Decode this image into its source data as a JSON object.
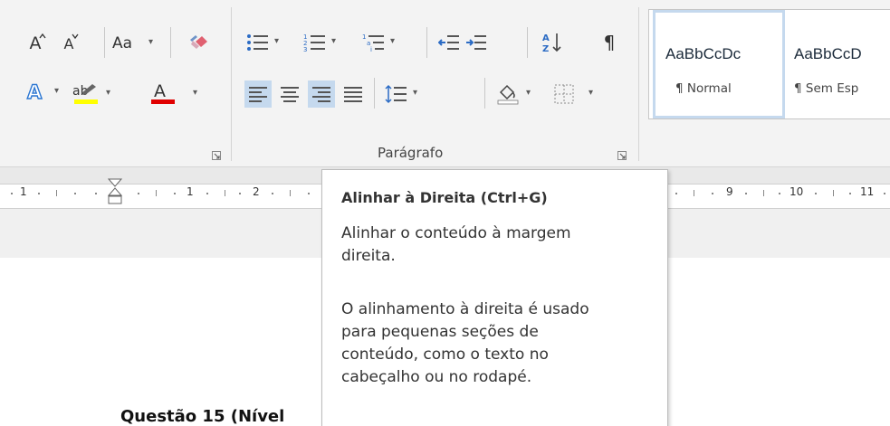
{
  "ribbon": {
    "font": {
      "change_case_label": "Aa",
      "grow_font_label": "A",
      "shrink_font_label": "A",
      "font_color_label": "A",
      "highlight_label": "ab",
      "highlight_color": "#ffff00",
      "font_color": "#e00000"
    },
    "paragraph": {
      "group_label": "Parágrafo",
      "show_marks_glyph": "¶"
    },
    "styles": {
      "items": [
        {
          "sample": "AaBbCcDc",
          "name": "¶ Normal",
          "selected": true
        },
        {
          "sample": "AaBbCcD",
          "name": "¶ Sem Esp",
          "selected": false
        }
      ]
    }
  },
  "ruler": {
    "labels": [
      "1",
      "1",
      "2",
      "9",
      "10",
      "11"
    ]
  },
  "tooltip": {
    "title": "Alinhar à Direita (Ctrl+G)",
    "lines": [
      "Alinhar o conteúdo à margem",
      "direita.",
      "O alinhamento à direita é usado",
      "para pequenas seções de",
      "conteúdo, como o texto no",
      "cabeçalho ou no rodapé."
    ]
  },
  "document": {
    "visible_text": "Questão 15 (Nível"
  },
  "colors": {
    "selected_button_bg": "#c5d9ee",
    "icon_blue": "#2b579a",
    "ribbon_bg": "#f3f3f3"
  }
}
